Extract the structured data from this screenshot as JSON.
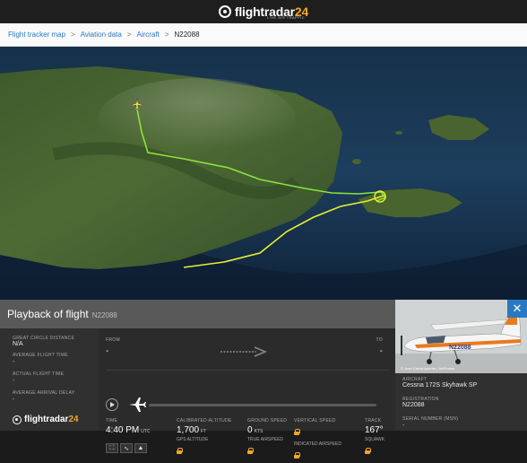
{
  "header": {
    "logo_text": "flightradar",
    "logo_num": "24",
    "logo_sub": "LIVE AIR TRAFFIC"
  },
  "breadcrumb": {
    "items": [
      "Flight tracker map",
      "Aviation data",
      "Aircraft"
    ],
    "separator": ">",
    "current": "N22088"
  },
  "playback": {
    "title": "Playback of flight",
    "registration": "N22088",
    "left_stats": [
      {
        "label": "GREAT CIRCLE DISTANCE",
        "value": "N/A"
      },
      {
        "label": "AVERAGE FLIGHT TIME",
        "value": "-"
      },
      {
        "label": "ACTUAL FLIGHT TIME",
        "value": "-"
      },
      {
        "label": "AVERAGE ARRIVAL DELAY",
        "value": "-"
      }
    ],
    "from_label": "FROM",
    "from_value": "-",
    "to_label": "TO",
    "to_value": "-",
    "fields": {
      "time_label": "TIME",
      "time_value": "4:40 PM",
      "time_unit": "UTC",
      "cal_alt_label": "CALIBRATED ALTITUDE",
      "cal_alt_value": "1,700",
      "cal_alt_unit": "FT",
      "gps_alt_label": "GPS ALTITUDE",
      "ground_speed_label": "GROUND SPEED",
      "ground_speed_value": "0",
      "ground_speed_unit": "KTS",
      "true_airspeed_label": "TRUE AIRSPEED",
      "vert_speed_label": "VERTICAL SPEED",
      "ind_airspeed_label": "INDICATED AIRSPEED",
      "track_label": "TRACK",
      "track_value": "167°",
      "squawk_label": "SQUAWK"
    },
    "footer_logo_text": "flightradar",
    "footer_logo_num": "24"
  },
  "aircraft": {
    "photo_credit": "© Juan Carlos Aponte | JetPhotos",
    "aircraft_label": "AIRCRAFT",
    "aircraft_value": "Cessna 172S Skyhawk SP",
    "registration_label": "REGISTRATION",
    "registration_value": "N22088",
    "serial_label": "SERIAL NUMBER (MSN)",
    "serial_value": "-",
    "tail_text": "N22088"
  },
  "colors": {
    "brand_orange": "#f5a623",
    "link_blue": "#2b78c2",
    "track_green": "#8be33b",
    "track_yellow": "#e9f02b"
  }
}
